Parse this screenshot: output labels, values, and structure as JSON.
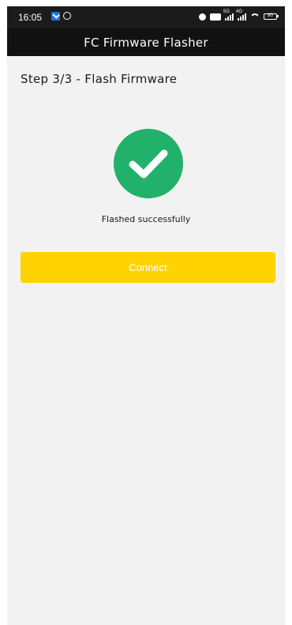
{
  "status_bar": {
    "time": "16:05",
    "signal_5g": "5G",
    "signal_4g": "4G",
    "battery": "80"
  },
  "app_bar": {
    "title": "FC Firmware Flasher"
  },
  "content": {
    "step_title": "Step 3/3 - Flash Firmware",
    "status_message": "Flashed successfully",
    "connect_label": "Connect"
  },
  "colors": {
    "success_green": "#21b16a",
    "button_yellow": "#ffd300",
    "app_bar": "#111111",
    "background": "#f2f2f2"
  },
  "icons": {
    "success": "check-circle-icon"
  }
}
